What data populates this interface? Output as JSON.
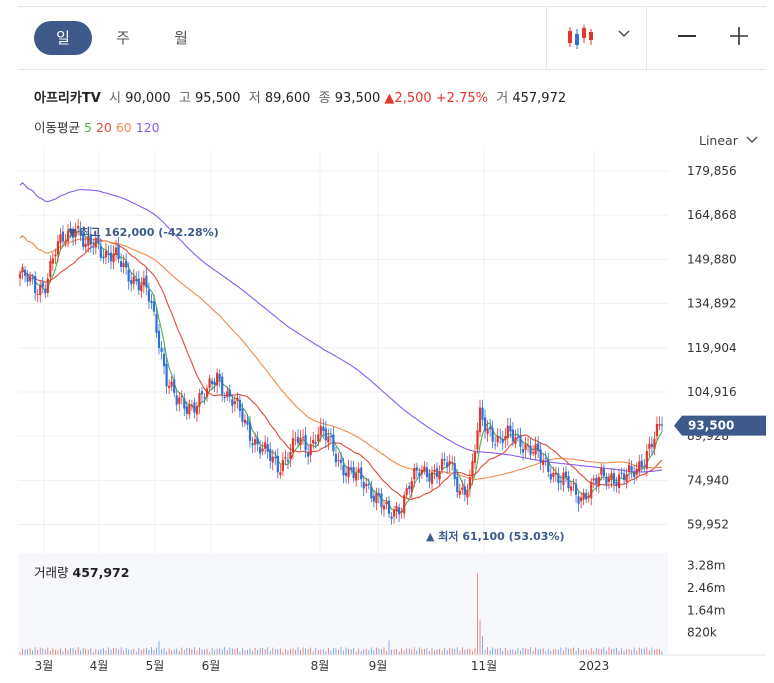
{
  "tabs": [
    {
      "label": "일",
      "active": true
    },
    {
      "label": "주",
      "active": false
    },
    {
      "label": "월",
      "active": false
    }
  ],
  "toolbar": {
    "chart_type_icon": "candlestick-icon",
    "dropdown_icon": "chevron-down-icon",
    "zoom_out": "—",
    "zoom_in": "+"
  },
  "stock": {
    "name": "아프리카TV",
    "open_label": "시",
    "open": "90,000",
    "high_label": "고",
    "high": "95,500",
    "low_label": "저",
    "low": "89,600",
    "close_label": "종",
    "close": "93,500",
    "change_arrow": "▲",
    "change": "2,500",
    "change_pct": "+2.75%",
    "volume_label": "거",
    "volume": "457,972"
  },
  "moving_average": {
    "label": "이동평균",
    "periods": [
      {
        "label": "5",
        "color": "#4caf50"
      },
      {
        "label": "20",
        "color": "#e04a3a"
      },
      {
        "label": "60",
        "color": "#f08a4b"
      },
      {
        "label": "120",
        "color": "#8a5cf0"
      }
    ]
  },
  "scale": {
    "label": "Linear",
    "icon": "chevron-down-icon"
  },
  "colors": {
    "up": "#e0372c",
    "down": "#2f6fd6",
    "price_tag": "#3d5a8a",
    "grid": "#f0f0f0"
  },
  "chart_data": {
    "type": "candlestick",
    "price_axis": {
      "ticks": [
        "179,856",
        "164,868",
        "149,880",
        "134,892",
        "119,904",
        "104,916",
        "89,928",
        "74,940",
        "59,952"
      ],
      "tick_values": [
        179856,
        164868,
        149880,
        134892,
        119904,
        104916,
        89928,
        74940,
        59952
      ]
    },
    "x_axis": {
      "ticks": [
        "3월",
        "4월",
        "5월",
        "6월",
        "8월",
        "9월",
        "11월",
        "2023"
      ]
    },
    "last_price_tag": "93,500",
    "high_annotation": {
      "text": "▼ 최고 162,000 (-42.28%)",
      "value": 162000
    },
    "low_annotation": {
      "text": "▲ 최저 61,100 (53.03%)",
      "value": 61100
    },
    "volume": {
      "label": "거래량",
      "value": "457,972",
      "ticks": [
        "3.28m",
        "2.46m",
        "1.64m",
        "820k"
      ],
      "tick_values": [
        3280000,
        2460000,
        1640000,
        820000
      ]
    },
    "series_anchor_close": [
      [
        0,
        145000
      ],
      [
        6,
        140000
      ],
      [
        10,
        142000
      ],
      [
        14,
        152000
      ],
      [
        18,
        158000
      ],
      [
        22,
        162000
      ],
      [
        26,
        153000
      ],
      [
        30,
        156000
      ],
      [
        34,
        152000
      ],
      [
        38,
        150000
      ],
      [
        42,
        146000
      ],
      [
        46,
        143000
      ],
      [
        50,
        139000
      ],
      [
        54,
        127000
      ],
      [
        58,
        110000
      ],
      [
        62,
        101000
      ],
      [
        66,
        100000
      ],
      [
        70,
        102000
      ],
      [
        74,
        104000
      ],
      [
        78,
        111000
      ],
      [
        82,
        104000
      ],
      [
        86,
        99000
      ],
      [
        90,
        93000
      ],
      [
        94,
        87000
      ],
      [
        98,
        83000
      ],
      [
        102,
        80000
      ],
      [
        106,
        84000
      ],
      [
        110,
        88000
      ],
      [
        114,
        86000
      ],
      [
        118,
        92000
      ],
      [
        122,
        88000
      ],
      [
        126,
        82000
      ],
      [
        130,
        78000
      ],
      [
        134,
        75000
      ],
      [
        138,
        73000
      ],
      [
        142,
        69000
      ],
      [
        146,
        62000
      ],
      [
        150,
        66000
      ],
      [
        154,
        74000
      ],
      [
        158,
        77000
      ],
      [
        162,
        78000
      ],
      [
        166,
        79000
      ],
      [
        170,
        80000
      ],
      [
        174,
        72000
      ],
      [
        178,
        74000
      ],
      [
        182,
        96000
      ],
      [
        186,
        92000
      ],
      [
        190,
        88000
      ],
      [
        194,
        90000
      ],
      [
        198,
        89000
      ],
      [
        202,
        85000
      ],
      [
        206,
        82000
      ],
      [
        210,
        79000
      ],
      [
        214,
        75000
      ],
      [
        218,
        72000
      ],
      [
        222,
        70000
      ],
      [
        226,
        72000
      ],
      [
        230,
        76000
      ],
      [
        234,
        77000
      ],
      [
        238,
        75000
      ],
      [
        242,
        77000
      ],
      [
        246,
        82000
      ],
      [
        250,
        87000
      ],
      [
        254,
        93500
      ]
    ]
  }
}
